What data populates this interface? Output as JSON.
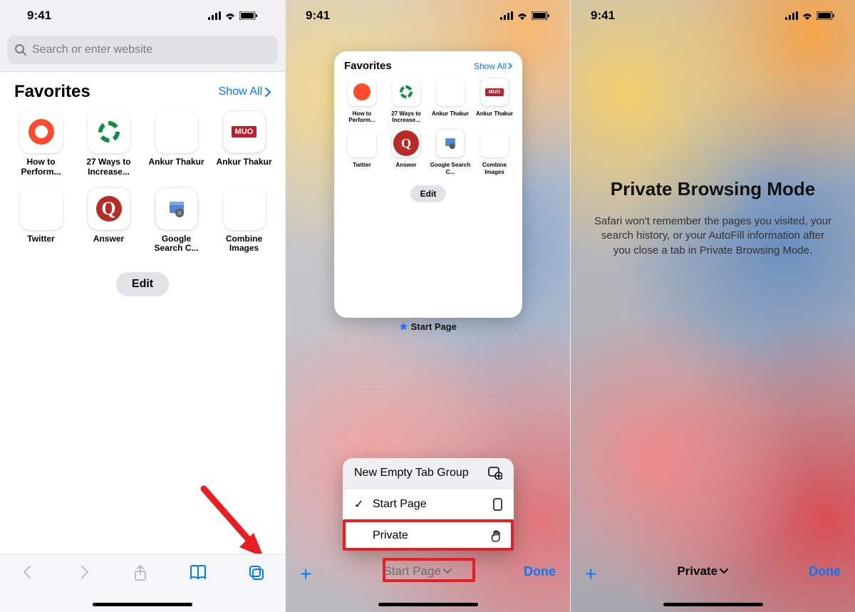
{
  "status": {
    "time": "9:41"
  },
  "screen1": {
    "search_placeholder": "Search or enter website",
    "favorites_heading": "Favorites",
    "show_all": "Show All",
    "edit": "Edit",
    "favorites": [
      {
        "label": "How to Perform..."
      },
      {
        "label": "27 Ways to Increase..."
      },
      {
        "label": "Ankur Thakur"
      },
      {
        "label": "Ankur Thakur"
      },
      {
        "label": "Twitter"
      },
      {
        "label": "Answer"
      },
      {
        "label": "Google Search C..."
      },
      {
        "label": "Combine Images"
      }
    ]
  },
  "screen2": {
    "favorites_heading": "Favorites",
    "show_all": "Show All",
    "edit": "Edit",
    "favorites": [
      {
        "label": "How to Perform..."
      },
      {
        "label": "27 Ways to Increase..."
      },
      {
        "label": "Ankur Thakur"
      },
      {
        "label": "Ankur Thakur"
      },
      {
        "label": "Twitter"
      },
      {
        "label": "Answer"
      },
      {
        "label": "Google Search C..."
      },
      {
        "label": "Combine Images"
      }
    ],
    "tab_caption": "Start Page",
    "menu": {
      "new_group": "New Empty Tab Group",
      "start_page": "Start Page",
      "private": "Private"
    },
    "toolbar_label": "Start Page",
    "done": "Done"
  },
  "screen3": {
    "title": "Private Browsing Mode",
    "body": "Safari won't remember the pages you visited, your search history, or your AutoFill information after you close a tab in Private Browsing Mode.",
    "toolbar_label": "Private",
    "done": "Done"
  },
  "colors": {
    "ios_blue": "#007aff",
    "highlight_red": "#ec1c24"
  }
}
